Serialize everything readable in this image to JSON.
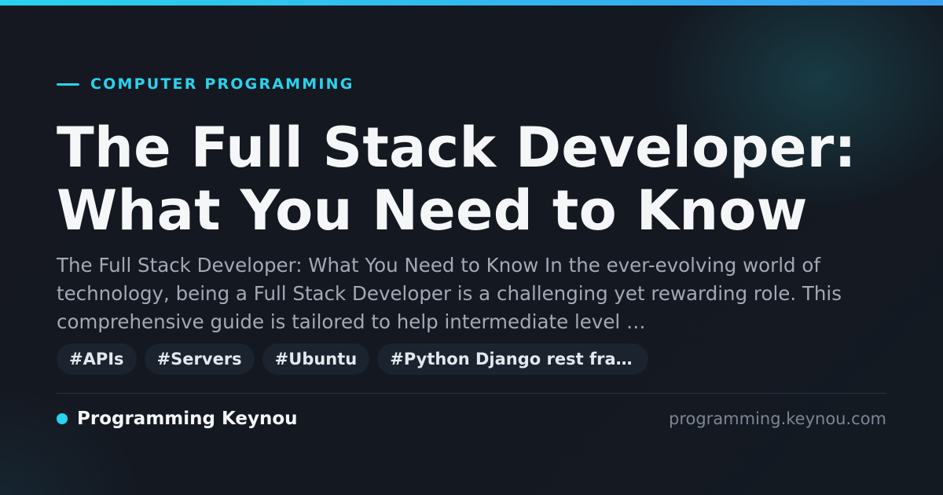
{
  "theme": {
    "accent": "#29d3ee",
    "accent_end": "#3aa0f0",
    "background": "#13161e",
    "title_color": "#f5f6f8",
    "excerpt_color": "#a3a9b5",
    "tag_background": "#1b232e",
    "url_color": "#7e8593"
  },
  "category": {
    "label": "COMPUTER PROGRAMMING",
    "icon": "accent-dash"
  },
  "title": {
    "line1": "The Full Stack Developer:",
    "line2": "What You Need to Know"
  },
  "excerpt": "The Full Stack Developer: What You Need to Know In the ever-evolving world of technology, being a Full Stack Developer is a challenging yet rewarding role. This comprehensive guide is tailored to help intermediate level …",
  "tags": [
    "#APIs",
    "#Servers",
    "#Ubuntu",
    "#Python Django rest fram…"
  ],
  "footer": {
    "brand_icon": "accent-dot",
    "brand_name": "Programming Keynou",
    "site_url": "programming.keynou.com"
  }
}
